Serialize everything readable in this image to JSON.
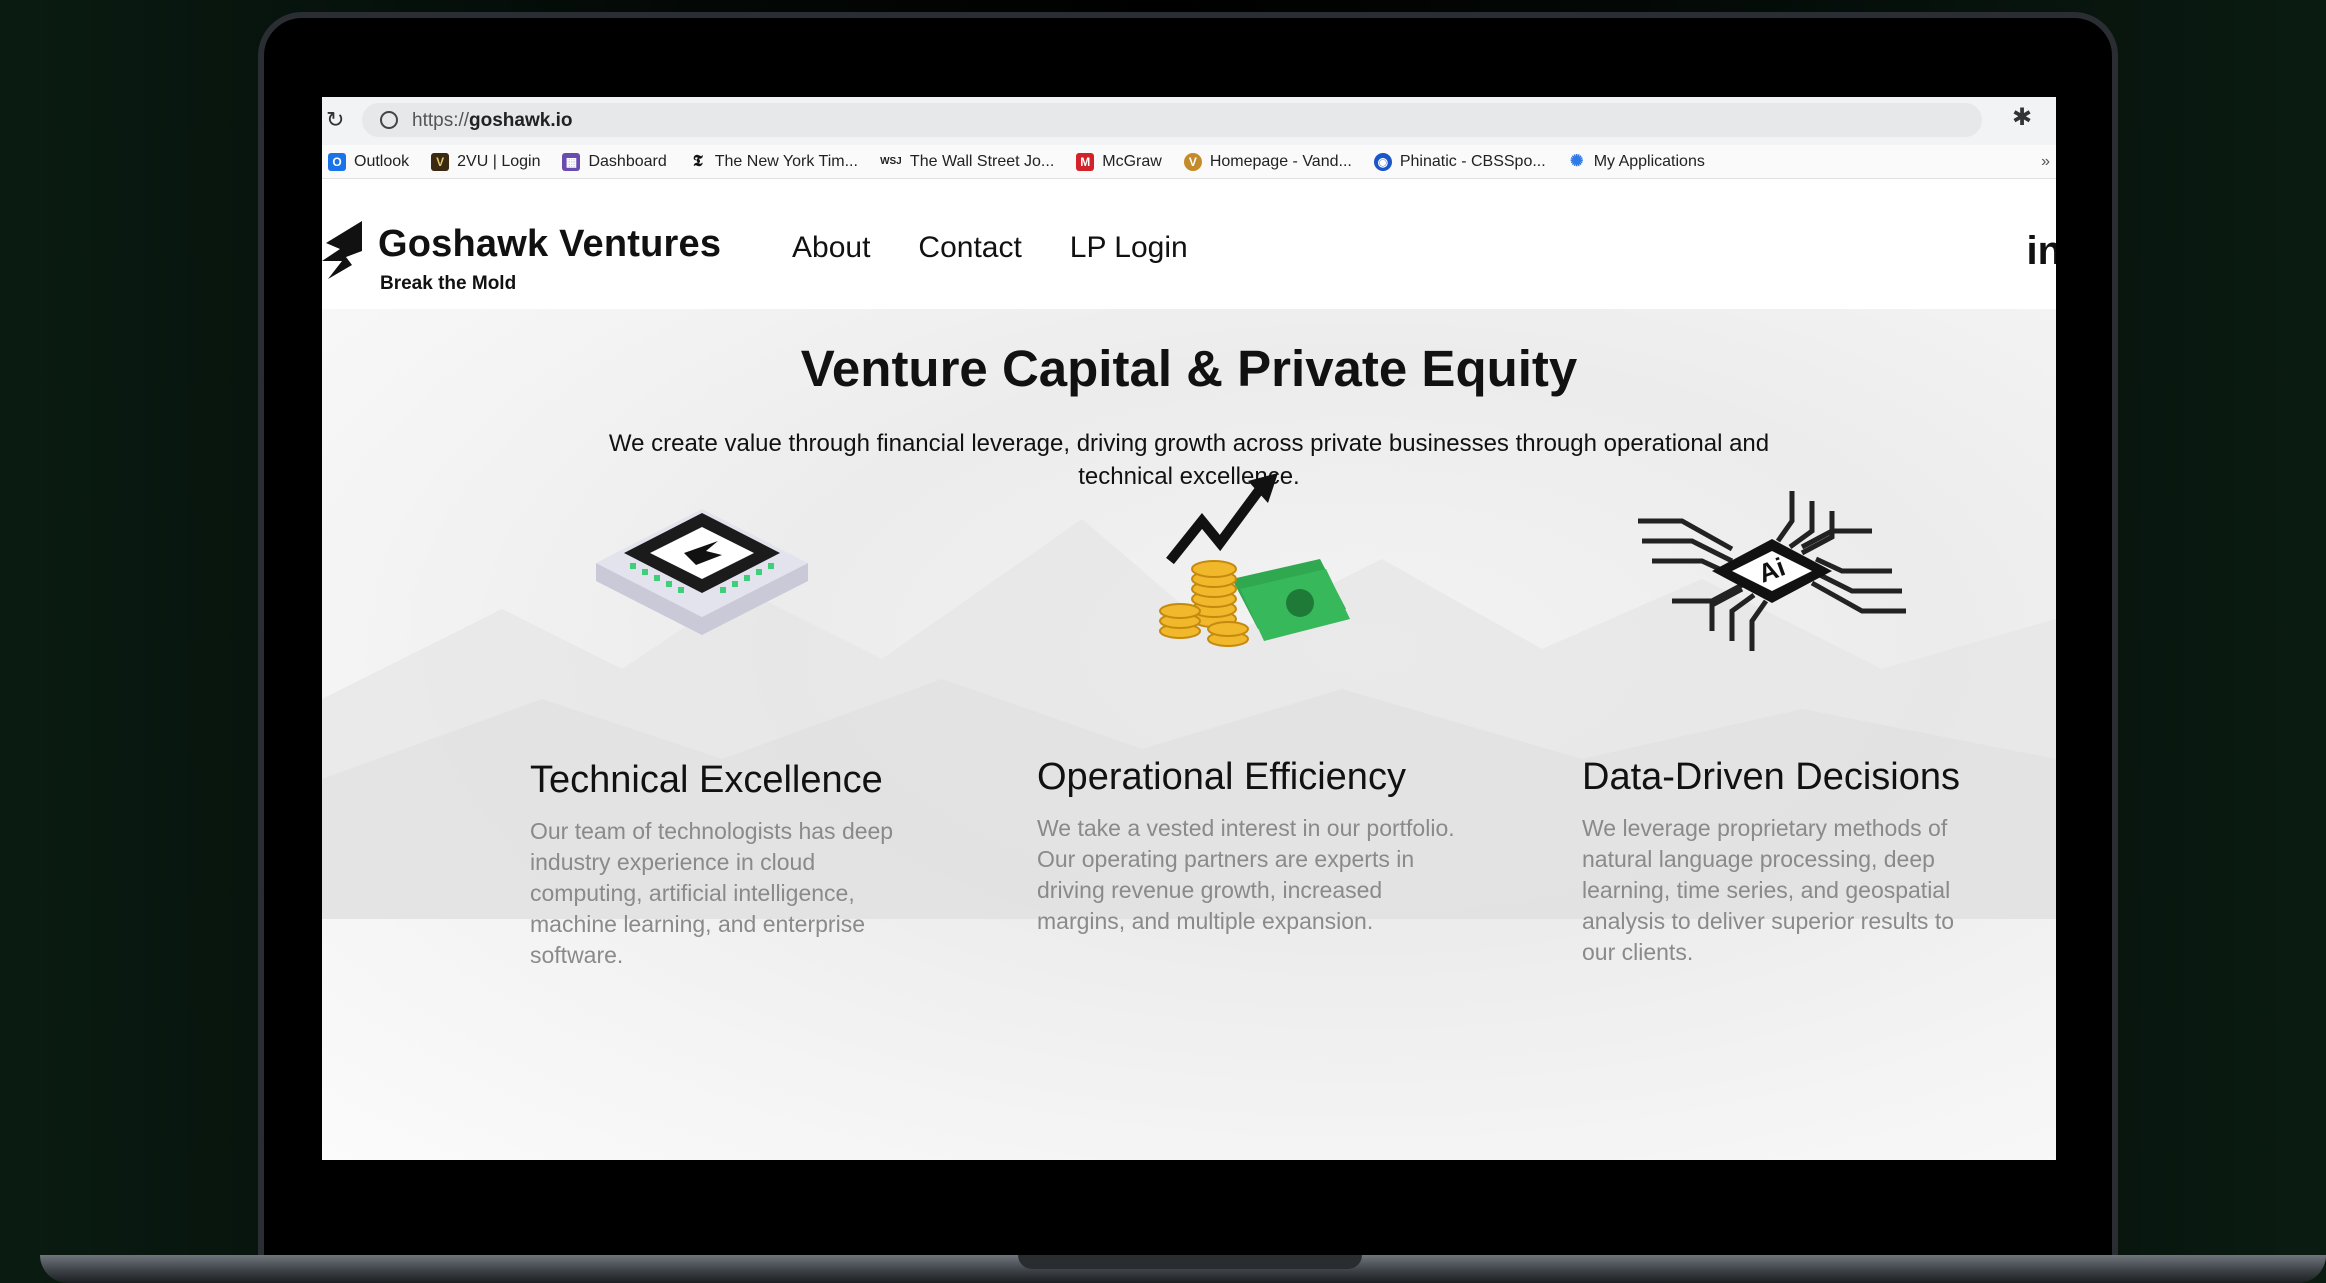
{
  "browser": {
    "url_protocol": "https://",
    "url_host": "goshawk.io",
    "bookmarks": [
      {
        "label": "Outlook",
        "icon": "outlook-icon",
        "color": "#1a73e8"
      },
      {
        "label": "2VU | Login",
        "icon": "vu-icon",
        "color": "#3a2a12"
      },
      {
        "label": "Dashboard",
        "icon": "dashboard-icon",
        "color": "#6a4bb0"
      },
      {
        "label": "The New York Tim...",
        "icon": "nyt-icon",
        "color": "#111111"
      },
      {
        "label": "The Wall Street Jo...",
        "icon": "wsj-icon",
        "color": "#222222"
      },
      {
        "label": "McGraw",
        "icon": "mcgraw-icon",
        "color": "#d2232a"
      },
      {
        "label": "Homepage - Vand...",
        "icon": "vanderbilt-icon",
        "color": "#c58a2a"
      },
      {
        "label": "Phinatic - CBSSpo...",
        "icon": "cbs-icon",
        "color": "#1a56c8"
      },
      {
        "label": "My Applications",
        "icon": "lightbulb-icon",
        "color": "#2f7ae5"
      }
    ]
  },
  "site": {
    "brand_name": "Goshawk Ventures",
    "brand_tagline": "Break the Mold",
    "nav": [
      "About",
      "Contact",
      "LP Login"
    ],
    "social": "in"
  },
  "hero": {
    "title": "Venture Capital & Private Equity",
    "subtitle": "We create value through financial leverage, driving growth across private businesses through operational and technical excellence."
  },
  "features": [
    {
      "title": "Technical Excellence",
      "body": "Our team of technologists has deep industry experience in cloud computing, artificial intelligence, machine learning, and enterprise software.",
      "icon": "chip-icon"
    },
    {
      "title": "Operational Efficiency",
      "body": "We take a vested interest in our portfolio. Our operating partners are experts in driving revenue growth, increased margins, and multiple expansion.",
      "icon": "money-growth-icon"
    },
    {
      "title": "Data-Driven Decisions",
      "body": "We leverage proprietary methods of natural language processing, deep learning, time series, and geospatial analysis to deliver superior results to our clients.",
      "icon": "ai-chip-icon",
      "icon_text": "Ai"
    }
  ],
  "colors": {
    "chip_pins": "#3fcf7a",
    "money_green": "#2fa84f",
    "coin_gold": "#f0b82a"
  }
}
